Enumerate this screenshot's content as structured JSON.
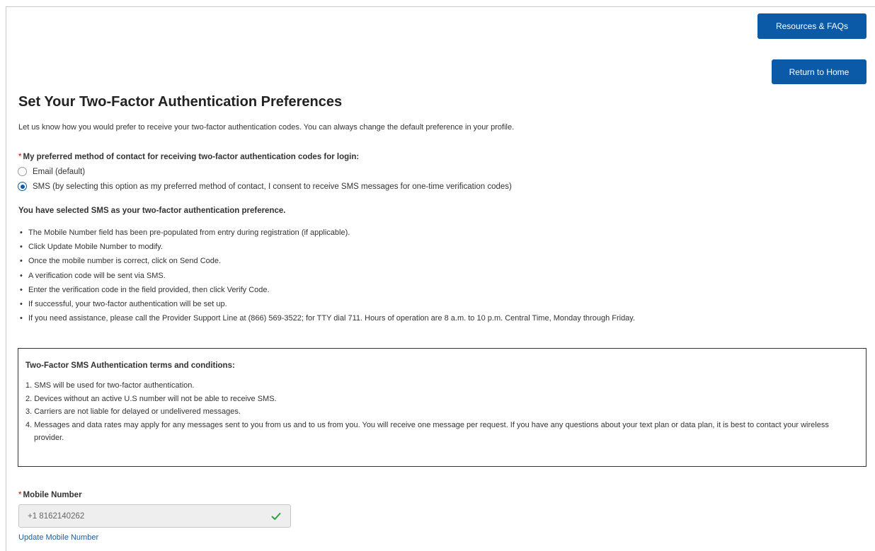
{
  "header": {
    "resources_label": "Resources & FAQs",
    "home_label": "Return to Home"
  },
  "page": {
    "title": "Set Your Two-Factor Authentication Preferences",
    "intro": "Let us know how you would prefer to receive your two-factor authentication codes. You can always change the default preference in your profile."
  },
  "preference": {
    "required_mark": "*",
    "question": "My preferred method of contact for receiving two-factor authentication codes for login:",
    "options": [
      {
        "label": "Email (default)",
        "selected": false
      },
      {
        "label": "SMS (by selecting this option as my preferred method of contact, I consent to receive SMS messages for one-time verification codes)",
        "selected": true
      }
    ],
    "selected_note": "You have selected SMS as your two-factor authentication preference."
  },
  "instructions": [
    "The Mobile Number field has been pre-populated from entry during registration (if applicable).",
    "Click Update Mobile Number to modify.",
    "Once the mobile number is correct, click on Send Code.",
    "A verification code will be sent via SMS.",
    "Enter the verification code in the field provided, then click Verify Code.",
    "If successful, your two-factor authentication will be set up.",
    "If you need assistance, please call the Provider Support Line at (866) 569-3522; for TTY dial 711. Hours of operation are 8 a.m. to 10 p.m. Central Time, Monday through Friday."
  ],
  "terms": {
    "title": "Two-Factor SMS Authentication terms and conditions:",
    "items": [
      "1. SMS will be used for two-factor authentication.",
      "2. Devices without an active U.S number will not be able to receive SMS.",
      "3. Carriers are not liable for delayed or undelivered messages.",
      "4. Messages and data rates may apply for any messages sent to you from us and to us from you. You will receive one message per request. If you have any questions about your text plan or data plan, it is best to contact your wireless provider."
    ]
  },
  "mobile": {
    "required_mark": "*",
    "label": "Mobile Number",
    "value": "+1 8162140262",
    "update_link": "Update Mobile Number",
    "valid_color": "#2e9e3e"
  },
  "colors": {
    "primary": "#0b5aa8",
    "required": "#c00000",
    "link": "#1a5e9c"
  }
}
